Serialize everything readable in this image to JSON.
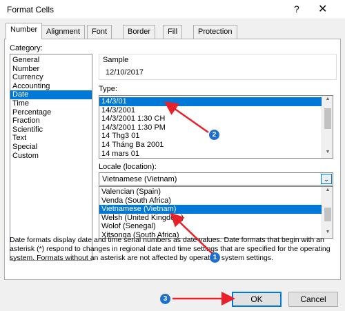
{
  "window": {
    "title": "Format Cells",
    "help": "?",
    "close": "✕"
  },
  "tabs": [
    "Number",
    "Alignment",
    "Font",
    "Border",
    "Fill",
    "Protection"
  ],
  "category": {
    "label": "Category:",
    "items": [
      "General",
      "Number",
      "Currency",
      "Accounting",
      "Date",
      "Time",
      "Percentage",
      "Fraction",
      "Scientific",
      "Text",
      "Special",
      "Custom"
    ],
    "selected": "Date"
  },
  "sample": {
    "label": "Sample",
    "value": "12/10/2017"
  },
  "type": {
    "label": "Type:",
    "items": [
      "14/3/01",
      "14/3/2001",
      "14/3/2001 1:30 CH",
      "14/3/2001 1:30 PM",
      "14 Thg3 01",
      "14 Tháng Ba 2001",
      "14 mars 01"
    ],
    "selected": "14/3/01"
  },
  "locale": {
    "label": "Locale (location):",
    "value": "Vietnamese (Vietnam)",
    "options": [
      "Valencian (Spain)",
      "Venda (South Africa)",
      "Vietnamese (Vietnam)",
      "Welsh (United Kingdom)",
      "Wolof (Senegal)",
      "Xitsonga (South Africa)"
    ],
    "selected": "Vietnamese (Vietnam)"
  },
  "description": "Date formats display date and time serial numbers as date values. Date formats that begin with an asterisk (*) respond to changes in regional date and time settings that are specified for the operating system. Formats without an asterisk are not affected by operating system settings.",
  "buttons": {
    "ok": "OK",
    "cancel": "Cancel"
  },
  "annotations": {
    "marker1": "1",
    "marker2": "2",
    "marker3": "3",
    "arrow_color": "#e8202a",
    "marker_color": "#1e6fd0"
  },
  "colors": {
    "selection": "#0078d7",
    "focus_border": "#0078d7"
  }
}
